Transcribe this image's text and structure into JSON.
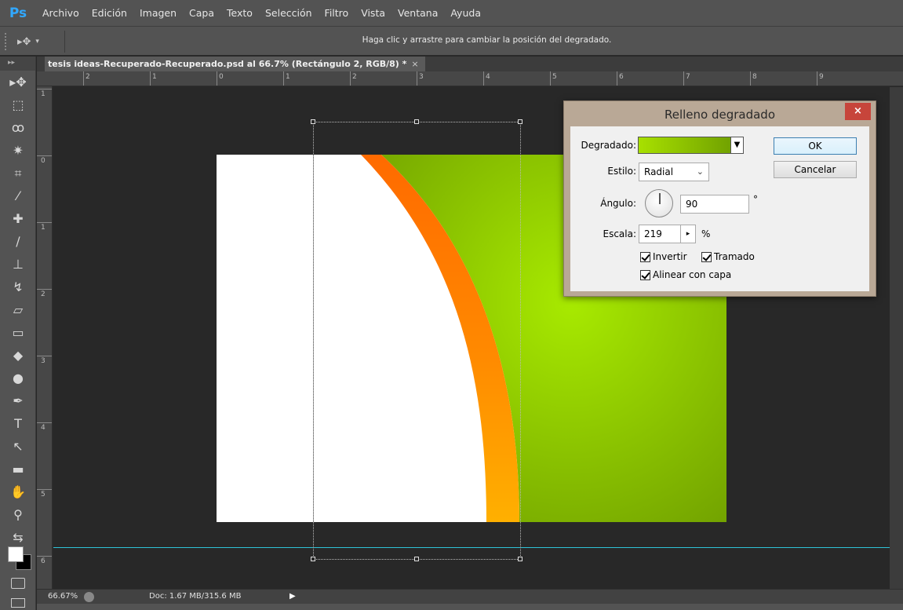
{
  "app": {
    "logo": "Ps",
    "menus": [
      "Archivo",
      "Edición",
      "Imagen",
      "Capa",
      "Texto",
      "Selección",
      "Filtro",
      "Vista",
      "Ventana",
      "Ayuda"
    ],
    "accent_color": "#31a8ff"
  },
  "options_bar": {
    "tool_icon": "move-tool-icon",
    "hint": "Haga clic y arrastre para cambiar la posición del degradado."
  },
  "document": {
    "tab_title": "tesis ideas-Recuperado-Recuperado.psd al 66.7% (Rectángulo 2, RGB/8) *",
    "close_glyph": "×"
  },
  "rulers": {
    "top_labels": [
      "2",
      "1",
      "0",
      "1",
      "2",
      "3",
      "4",
      "5",
      "6",
      "7",
      "8",
      "9"
    ],
    "left_labels": [
      "1",
      "0",
      "1",
      "2",
      "3",
      "4",
      "5",
      "6"
    ]
  },
  "toolbar": {
    "collapse_glyph": "▸▸",
    "tools": [
      {
        "name": "move-tool-icon",
        "glyph": "▸✥"
      },
      {
        "name": "marquee-tool-icon",
        "glyph": "⬚"
      },
      {
        "name": "lasso-tool-icon",
        "glyph": "ꝏ"
      },
      {
        "name": "magic-wand-tool-icon",
        "glyph": "✷"
      },
      {
        "name": "crop-tool-icon",
        "glyph": "⌗"
      },
      {
        "name": "eyedropper-tool-icon",
        "glyph": "⁄"
      },
      {
        "name": "healing-brush-tool-icon",
        "glyph": "✚"
      },
      {
        "name": "brush-tool-icon",
        "glyph": "∕"
      },
      {
        "name": "clone-stamp-tool-icon",
        "glyph": "⊥"
      },
      {
        "name": "history-brush-tool-icon",
        "glyph": "↯"
      },
      {
        "name": "eraser-tool-icon",
        "glyph": "▱"
      },
      {
        "name": "gradient-tool-icon",
        "glyph": "▭"
      },
      {
        "name": "blur-tool-icon",
        "glyph": "◆"
      },
      {
        "name": "dodge-tool-icon",
        "glyph": "●"
      },
      {
        "name": "pen-tool-icon",
        "glyph": "✒"
      },
      {
        "name": "type-tool-icon",
        "glyph": "T"
      },
      {
        "name": "path-selection-tool-icon",
        "glyph": "↖"
      },
      {
        "name": "rectangle-tool-icon",
        "glyph": "▬"
      },
      {
        "name": "hand-tool-icon",
        "glyph": "✋"
      },
      {
        "name": "zoom-tool-icon",
        "glyph": "⚲"
      },
      {
        "name": "swap-colors-icon",
        "glyph": "⇆"
      }
    ],
    "foreground_color": "#ffffff",
    "background_color": "#000000"
  },
  "status": {
    "zoom": "66.67%",
    "doc_size": "Doc: 1.67 MB/315.6 MB",
    "arrow": "▶"
  },
  "dialog": {
    "title": "Relleno degradado",
    "close_glyph": "×",
    "gradient_label": "Degradado:",
    "gradient_colors": [
      "#a8e000",
      "#6a9a00"
    ],
    "style_label": "Estilo:",
    "style_value": "Radial",
    "angle_label": "Ángulo:",
    "angle_value": "90",
    "angle_unit": "°",
    "scale_label": "Escala:",
    "scale_value": "219",
    "scale_unit": "%",
    "reverse_label": "Invertir",
    "reverse_checked": true,
    "dither_label": "Tramado",
    "dither_checked": true,
    "align_label": "Alinear con capa",
    "align_checked": true,
    "ok_label": "OK",
    "cancel_label": "Cancelar"
  },
  "canvas_art": {
    "green_light": "#a8ea00",
    "green_dark": "#6f9e00",
    "orange_outer": "#ff6a00",
    "orange_inner": "#ffb000"
  }
}
